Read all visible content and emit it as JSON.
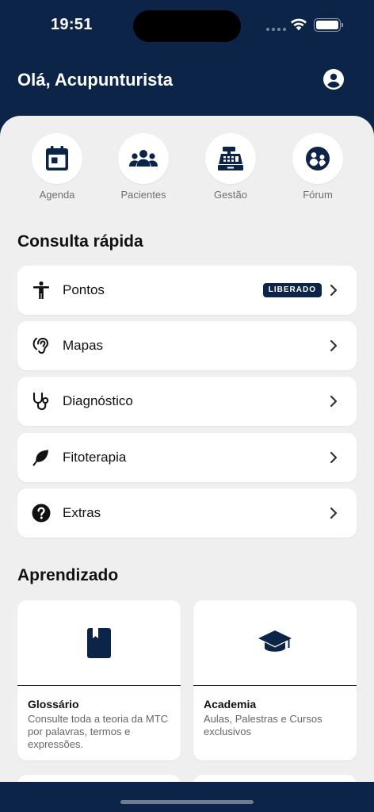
{
  "status_bar": {
    "time": "19:51"
  },
  "header": {
    "greeting": "Olá, Acupunturista",
    "profile_icon": "account-circle-icon"
  },
  "quick_access": [
    {
      "label": "Agenda",
      "icon": "calendar-icon"
    },
    {
      "label": "Pacientes",
      "icon": "people-icon"
    },
    {
      "label": "Gestão",
      "icon": "cash-register-icon"
    },
    {
      "label": "Fórum",
      "icon": "forum-icon"
    }
  ],
  "consulta_rapida": {
    "title": "Consulta rápida",
    "items": [
      {
        "label": "Pontos",
        "icon": "accessibility-icon",
        "badge": "LIBERADO"
      },
      {
        "label": "Mapas",
        "icon": "ear-icon"
      },
      {
        "label": "Diagnóstico",
        "icon": "stethoscope-icon"
      },
      {
        "label": "Fitoterapia",
        "icon": "leaf-icon"
      },
      {
        "label": "Extras",
        "icon": "help-circle-icon"
      }
    ]
  },
  "aprendizado": {
    "title": "Aprendizado",
    "cards": [
      {
        "title": "Glossário",
        "description": "Consulte toda a teoria da MTC por palavras, termos e expressões.",
        "icon": "book-icon"
      },
      {
        "title": "Academia",
        "description": "Aulas, Palestras e Cursos exclusivos",
        "icon": "graduation-cap-icon"
      }
    ]
  },
  "colors": {
    "primary": "#0b2447",
    "background": "#efefef",
    "card": "#ffffff"
  }
}
